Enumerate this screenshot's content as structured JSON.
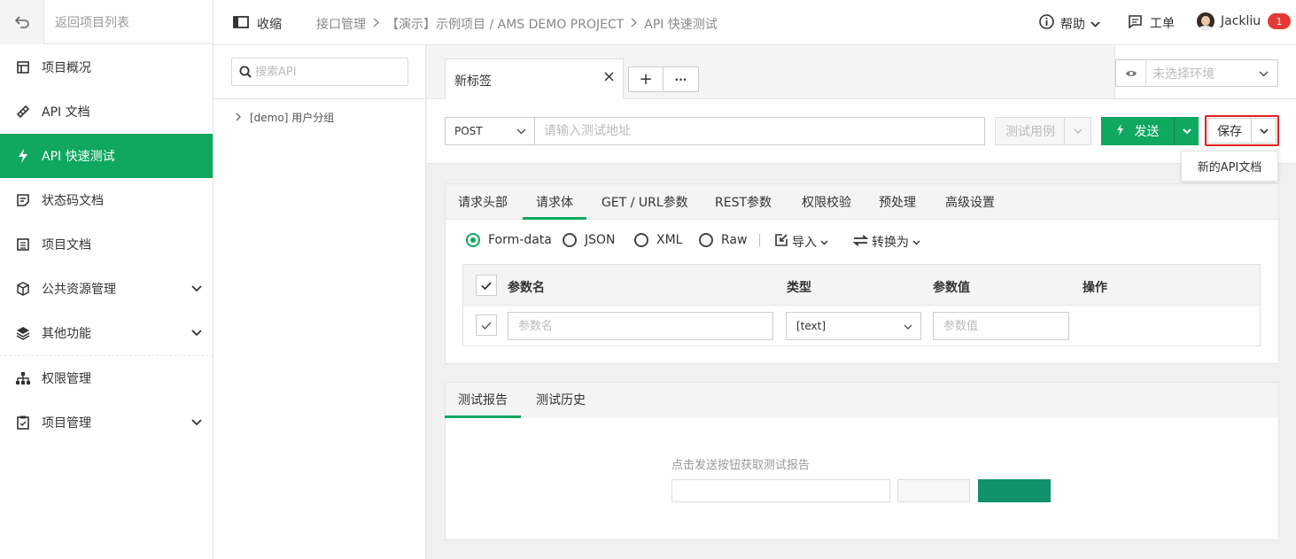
{
  "sidebar": {
    "back_label": "返回项目列表",
    "items": [
      {
        "label": "项目概况",
        "icon": "overview-icon"
      },
      {
        "label": "API 文档",
        "icon": "api-doc-icon"
      },
      {
        "label": "API 快速测试",
        "icon": "lightning-icon",
        "active": true
      },
      {
        "label": "状态码文档",
        "icon": "status-code-icon"
      },
      {
        "label": "项目文档",
        "icon": "project-doc-icon"
      },
      {
        "label": "公共资源管理",
        "icon": "cube-icon",
        "expandable": true
      },
      {
        "label": "其他功能",
        "icon": "layers-icon",
        "expandable": true
      },
      {
        "label": "权限管理",
        "icon": "org-chart-icon"
      },
      {
        "label": "项目管理",
        "icon": "clipboard-icon",
        "expandable": true
      }
    ]
  },
  "header": {
    "collapse_label": "收缩",
    "breadcrumb": [
      "接口管理",
      "【演示】示例项目 / AMS DEMO PROJECT",
      "API 快速测试"
    ],
    "help_label": "帮助",
    "ticket_label": "工单",
    "username": "Jackliu",
    "notification_count": "1"
  },
  "tree": {
    "search_placeholder": "搜索API",
    "group_label": "[demo] 用户分组"
  },
  "tabs": {
    "active_label": "新标签",
    "add_label": "+",
    "more_label": "···"
  },
  "env": {
    "placeholder": "未选择环境"
  },
  "request": {
    "method": "POST",
    "url_placeholder": "请输入测试地址",
    "test_case_label": "测试用例",
    "send_label": "发送",
    "save_label": "保存",
    "save_menu_item": "新的API文档"
  },
  "body_section": {
    "tabs": [
      "请求头部",
      "请求体",
      "GET / URL参数",
      "REST参数",
      "权限校验",
      "预处理",
      "高级设置"
    ],
    "active_tab": "请求体",
    "body_types": [
      "Form-data",
      "JSON",
      "XML",
      "Raw"
    ],
    "selected_type": "Form-data",
    "import_label": "导入",
    "convert_label": "转换为",
    "table_headers": {
      "name": "参数名",
      "type": "类型",
      "value": "参数值",
      "action": "操作"
    },
    "row": {
      "name_placeholder": "参数名",
      "type": "[text]",
      "value_placeholder": "参数值"
    }
  },
  "report_section": {
    "tabs": [
      "测试报告",
      "测试历史"
    ],
    "active_tab": "测试报告",
    "hint": "点击发送按钮获取测试报告"
  },
  "colors": {
    "accent": "#10a760",
    "badge": "#e53935",
    "highlight_outline": "#e02020"
  }
}
